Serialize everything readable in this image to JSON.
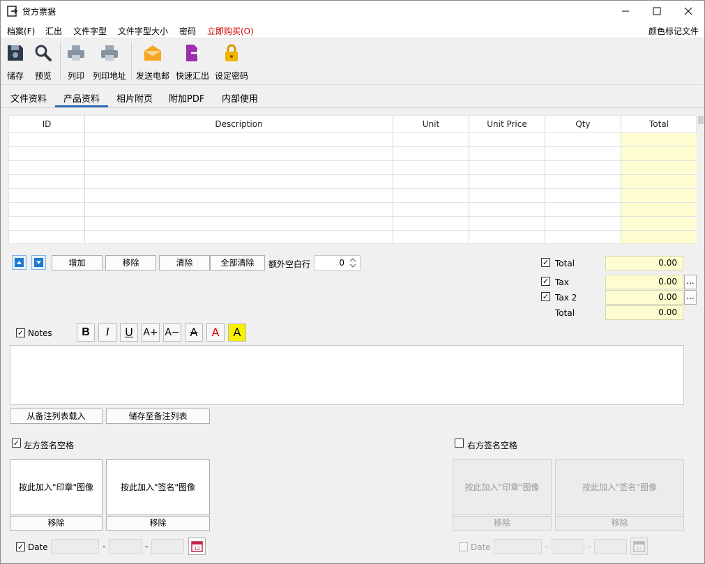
{
  "window": {
    "title": "贷方票据",
    "minimize": "—",
    "maximize": "☐",
    "close": "✕"
  },
  "menu": {
    "items": [
      "档案(F)",
      "汇出",
      "文件字型",
      "文件字型大小",
      "密码",
      "立即购买(O)"
    ],
    "right": "颜色标记文件",
    "highlight_color": "#d00000"
  },
  "toolbar": {
    "items": [
      {
        "label": "储存",
        "icon": "floppy-icon"
      },
      {
        "label": "预览",
        "icon": "magnifier-icon"
      },
      {
        "label": "列印",
        "icon": "printer-icon"
      },
      {
        "label": "列印地址",
        "icon": "printer-address-icon"
      },
      {
        "label": "发送电邮",
        "icon": "envelope-icon"
      },
      {
        "label": "快速汇出",
        "icon": "export-icon"
      },
      {
        "label": "设定密码",
        "icon": "padlock-icon"
      }
    ]
  },
  "tabs": {
    "items": [
      "文件资料",
      "产品资料",
      "相片附页",
      "附加PDF",
      "内部使用"
    ],
    "active": "产品资料"
  },
  "table": {
    "columns": [
      "ID",
      "Description",
      "Unit",
      "Unit Price",
      "Qty",
      "Total"
    ],
    "rows": 8
  },
  "row_controls": {
    "add": "增加",
    "remove": "移除",
    "clear": "清除",
    "clear_all": "全部清除",
    "extra_blank_label": "额外空白行",
    "extra_blank_value": "0"
  },
  "totals": {
    "total_label": "Total",
    "total_value": "0.00",
    "tax_label": "Tax",
    "tax_value": "0.00",
    "tax2_label": "Tax 2",
    "tax2_value": "0.00",
    "grand_label": "Total",
    "grand_value": "0.00",
    "more": "..."
  },
  "notes": {
    "label": "Notes",
    "load_button": "从备注列表载入",
    "save_button": "储存至备注列表",
    "format": {
      "bold": "B",
      "italic": "I",
      "underline": "U",
      "bigger": "A+",
      "smaller": "A−",
      "strike": "A",
      "color": "A",
      "highlight": "A"
    }
  },
  "signature_left": {
    "label": "左方签名空格",
    "checked": true,
    "stamp_button": "按此加入\"印章\"图像",
    "sign_button": "按此加入\"签名\"图像",
    "remove1": "移除",
    "remove2": "移除",
    "date_label": "Date",
    "date_sep": "-",
    "date_checked": true
  },
  "signature_right": {
    "label": "右方签名空格",
    "checked": false,
    "stamp_button": "按此加入\"印章\"图像",
    "sign_button": "按此加入\"签名\"图像",
    "remove1": "移除",
    "remove2": "移除",
    "date_label": "Date",
    "date_sep": "-",
    "date_checked": false
  },
  "colors": {
    "yellow": "#fdfdd0",
    "accent": "#2f6fb5",
    "email": "#f5a623",
    "export": "#9b2fae",
    "lock": "#f0b400"
  }
}
